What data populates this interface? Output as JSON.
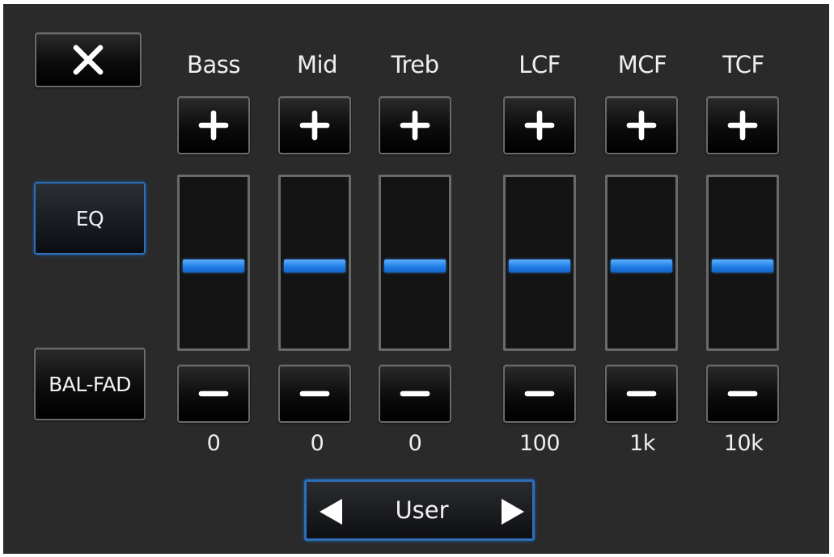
{
  "close": {
    "icon": "close-icon"
  },
  "side": {
    "eq_label": "EQ",
    "balfad_label": "BAL-FAD"
  },
  "bands": [
    {
      "label": "Bass",
      "value": "0",
      "level": 0.5
    },
    {
      "label": "Mid",
      "value": "0",
      "level": 0.5
    },
    {
      "label": "Treb",
      "value": "0",
      "level": 0.5
    },
    {
      "label": "LCF",
      "value": "100",
      "level": 0.5
    },
    {
      "label": "MCF",
      "value": "1k",
      "level": 0.5
    },
    {
      "label": "TCF",
      "value": "10k",
      "level": 0.5
    }
  ],
  "preset": {
    "label": "User",
    "prev_icon": "left-arrow-icon",
    "next_icon": "right-arrow-icon"
  },
  "colors": {
    "accent": "#1e7be4",
    "background": "#2a2a2a",
    "button_border": "#6a6a6a"
  }
}
